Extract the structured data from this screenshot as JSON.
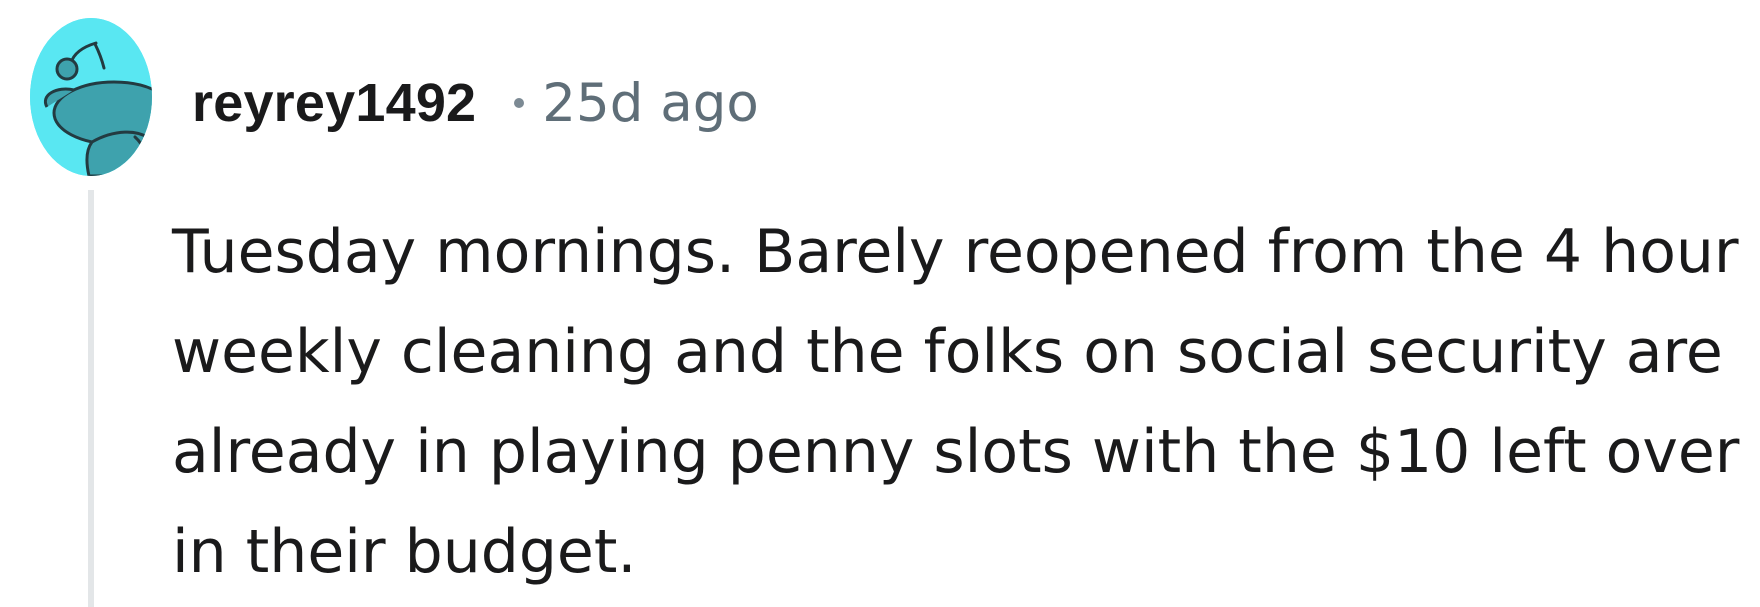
{
  "comment": {
    "username": "reyrey1492",
    "timestamp": "25d ago",
    "body": "Tuesday mornings. Barely reopened from the 4 hour weekly cleaning and the folks on social security are already in playing penny slots with the $10 left over in their budget."
  },
  "avatar": {
    "icon": "reddit-snoo-icon",
    "background_color": "#59e7f2",
    "figure_color": "#3ea2ad"
  },
  "colors": {
    "text": "#1a1a1b",
    "muted": "#5f6e78",
    "thread_line": "#e3e6e8"
  }
}
